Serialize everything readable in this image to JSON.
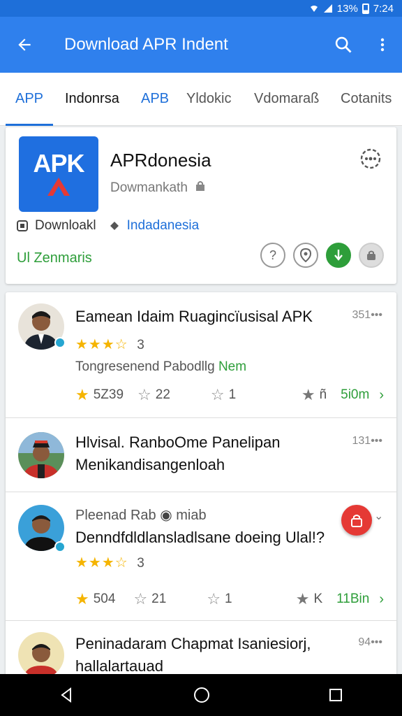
{
  "status": {
    "time": "7:24",
    "battery": "13%"
  },
  "app_bar": {
    "title": "Download APR Indent",
    "back_icon": "arrow-left-icon",
    "search_icon": "search-icon",
    "menu_icon": "more-vert-icon"
  },
  "tabs": [
    {
      "label": "APP",
      "active": true
    },
    {
      "label": "Indonrsa",
      "active": false
    },
    {
      "label": "APB",
      "active": false
    },
    {
      "label": "Yldokic",
      "active": false
    },
    {
      "label": "Vdomaraß",
      "active": false
    },
    {
      "label": "Cotanits",
      "active": false
    }
  ],
  "app": {
    "logo_text": "APK",
    "name": "APRdonesia",
    "developer": "Dowmankath",
    "download_label": "Downloakl",
    "region": "Indadanesia",
    "zen_label": "Ul Zenmaris"
  },
  "items": [
    {
      "title": "Eamean Idaim Ruagincïusisal APK",
      "time": "351•••",
      "rating_count": "3",
      "subtitle": "Tongresenend Pabodllg",
      "tag": "Nem",
      "stat1": "5Z39",
      "stat2": "22",
      "stat3": "1",
      "stat4": "ñ",
      "green_count": "5i0m"
    },
    {
      "title": "Hlvisal. RanboOme Panelipan",
      "title2": "Menikandisangenloah",
      "time": "131•••"
    },
    {
      "author": "Pleenad Rab",
      "author_suffix": "miab",
      "title": "Denndfdldlansladlsane doeing Ulal!?",
      "rating_count": "3",
      "stat1": "504",
      "stat2": "21",
      "stat3": "1",
      "stat4": "K",
      "green_count": "11Bin"
    },
    {
      "title": "Peninadaram Chapmat Isaniesiorj,",
      "title2": "hallalartauad",
      "time": "94•••"
    }
  ]
}
